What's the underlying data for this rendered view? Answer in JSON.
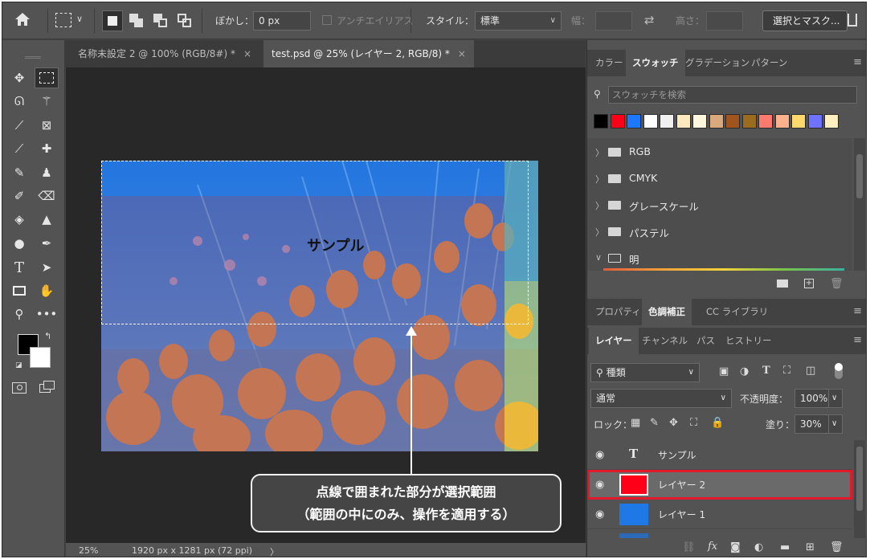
{
  "options": {
    "feather_label": "ぼかし：",
    "feather_value": "0 px",
    "antialias_label": "アンチエイリアス",
    "style_label": "スタイル：",
    "style_value": "標準",
    "width_label": "幅：",
    "height_label": "高さ：",
    "select_mask_button": "選択とマスク..."
  },
  "doc_tabs": [
    {
      "label": "名称未設定 2 @ 100% (RGB/8#) *",
      "close": "×"
    },
    {
      "label": "test.psd @ 25% (レイヤー 2, RGB/8) *",
      "close": "×"
    }
  ],
  "canvas": {
    "sample_text": "サンプル"
  },
  "callout": {
    "line1": "点線で囲まれた部分が選択範囲",
    "line2": "（範囲の中にのみ、操作を適用する）"
  },
  "status": {
    "zoom": "25%",
    "doc_info": "1920 px x 1281 px (72 ppi)",
    "arrow": "〉"
  },
  "swatch_panel": {
    "tabs": [
      "カラー",
      "スウォッチ",
      "グラデーション",
      "パターン"
    ],
    "search_placeholder": "スウォッチを検索",
    "colors": [
      "#000000",
      "#ff0019",
      "#1e78ff",
      "#ffffff",
      "#f0f0f0",
      "#fde9c0",
      "#fff6de",
      "#d9a87c",
      "#a0551f",
      "#9b6b1f",
      "#ff7a6e",
      "#ffb08c",
      "#ffd86e",
      "#6e72ff",
      "#fff0c2"
    ],
    "groups": [
      "RGB",
      "CMYK",
      "グレースケール",
      "パステル",
      "明"
    ]
  },
  "adjust_panel": {
    "tabs": [
      "プロパティ",
      "色調補正",
      "CC ライブラリ"
    ]
  },
  "layers_panel": {
    "tabs": [
      "レイヤー",
      "チャンネル",
      "パス",
      "ヒストリー"
    ],
    "filter_label": "種類",
    "blend_mode": "通常",
    "opacity_label": "不透明度：",
    "opacity_value": "100%",
    "lock_label": "ロック：",
    "fill_label": "塗り：",
    "fill_value": "30%",
    "layers": [
      {
        "name": "サンプル",
        "type": "text"
      },
      {
        "name": "レイヤー 2",
        "type": "pixel",
        "color": "#ff0019"
      },
      {
        "name": "レイヤー 1",
        "type": "pixel",
        "color": "#1e78e6"
      }
    ]
  }
}
